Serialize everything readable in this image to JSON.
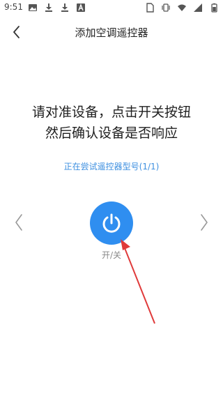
{
  "status_bar": {
    "time": "9:51",
    "left_icons": [
      "image-icon",
      "download-icon",
      "download-icon",
      "a-badge-icon"
    ],
    "right_icons": [
      "sim-icon",
      "vibrate-icon",
      "wifi-icon",
      "signal-icon",
      "battery-icon"
    ]
  },
  "header": {
    "title": "添加空调遥控器",
    "back_icon": "back-arrow-icon"
  },
  "instructions": {
    "line1": "请对准设备，点击开关按钮",
    "line2": "然后确认设备是否响应"
  },
  "status_text": "正在尝试遥控器型号(1/1)",
  "power": {
    "label": "开/关",
    "icon": "power-icon"
  },
  "nav": {
    "prev_icon": "chevron-left-icon",
    "next_icon": "chevron-right-icon"
  },
  "colors": {
    "accent": "#2f8ef0",
    "status_text": "#3d8fe0",
    "annotation": "#e03a3a"
  }
}
